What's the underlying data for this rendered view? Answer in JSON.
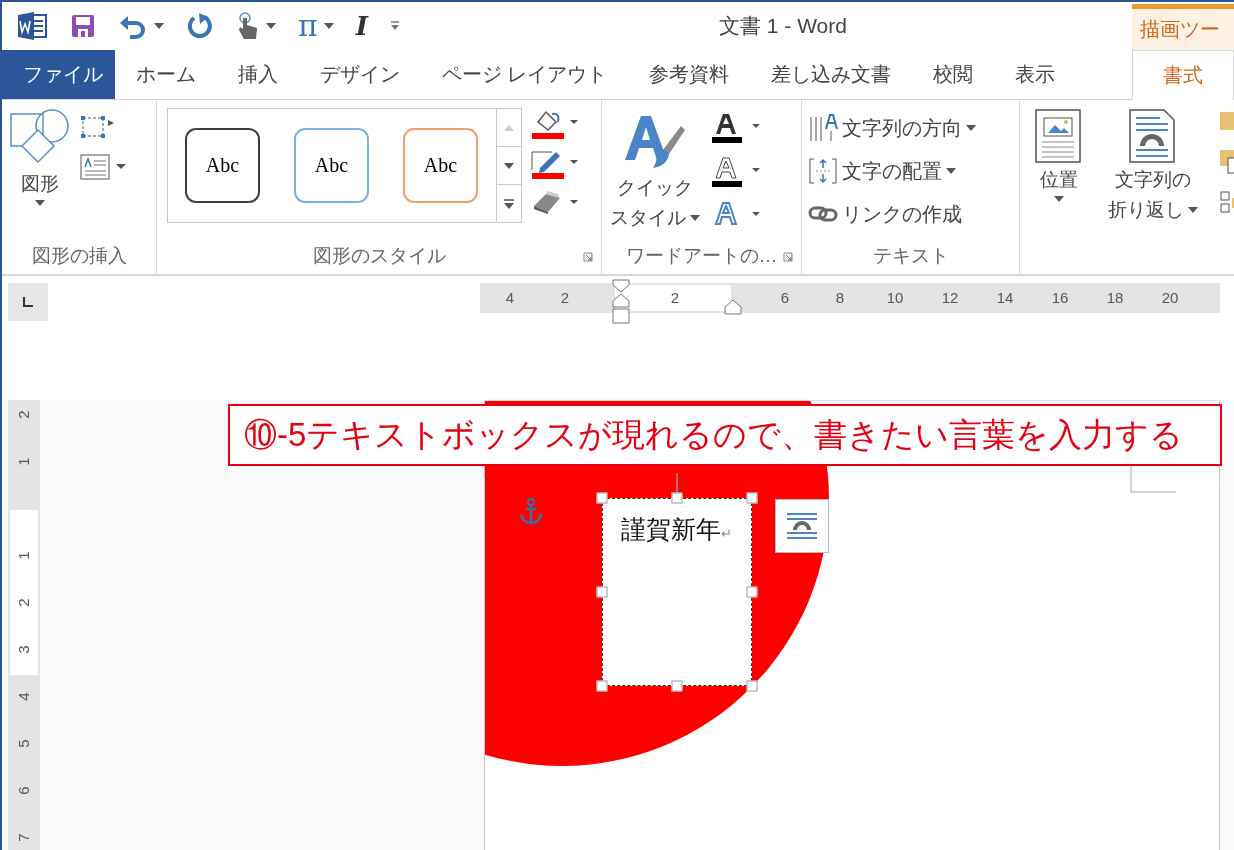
{
  "quick_access": [
    {
      "kind": "word-logo",
      "caret": false
    },
    {
      "kind": "save",
      "caret": false
    },
    {
      "kind": "undo",
      "caret": true
    },
    {
      "kind": "redo",
      "caret": false
    },
    {
      "kind": "touch",
      "caret": true
    },
    {
      "kind": "glyph",
      "glyph": "π",
      "caret": true
    },
    {
      "kind": "glyph",
      "glyph": "I",
      "caret": false
    },
    {
      "kind": "customize",
      "caret": false
    }
  ],
  "window": {
    "title": "文書 1 - Word"
  },
  "context_group": {
    "label": "描画ツー"
  },
  "tabs": [
    {
      "label": "ファイル",
      "kind": "file",
      "selected": false
    },
    {
      "label": "ホーム",
      "kind": "normal",
      "selected": false
    },
    {
      "label": "挿入",
      "kind": "normal",
      "selected": false
    },
    {
      "label": "デザイン",
      "kind": "normal",
      "selected": false
    },
    {
      "label": "ページ レイアウト",
      "kind": "normal",
      "selected": false
    },
    {
      "label": "参考資料",
      "kind": "normal",
      "selected": false
    },
    {
      "label": "差し込み文書",
      "kind": "normal",
      "selected": false
    },
    {
      "label": "校閲",
      "kind": "normal",
      "selected": false
    },
    {
      "label": "表示",
      "kind": "normal",
      "selected": false
    },
    {
      "label": "書式",
      "kind": "contextual",
      "selected": true
    }
  ],
  "ribbon": {
    "groups": [
      {
        "kind": "insert-shapes",
        "label": "図形の挿入",
        "launcher": false,
        "button": {
          "lines": [
            "図形"
          ]
        }
      },
      {
        "kind": "shape-styles",
        "label": "図形のスタイル",
        "launcher": true,
        "styles": [
          {
            "text": "Abc",
            "color": "#404040"
          },
          {
            "text": "Abc",
            "color": "#7eb0e0"
          },
          {
            "text": "Abc",
            "color": "#f0a070"
          }
        ]
      },
      {
        "kind": "wordart",
        "label": "ワードアートの…",
        "launcher": true,
        "button": {
          "lines": [
            "クイック",
            "スタイル"
          ]
        }
      },
      {
        "kind": "text",
        "label": "テキスト",
        "launcher": false,
        "commands": [
          {
            "label": "文字列の方向",
            "caret": true
          },
          {
            "label": "文字の配置",
            "caret": true
          },
          {
            "label": "リンクの作成",
            "caret": false
          }
        ]
      },
      {
        "kind": "arrange",
        "launcher": false,
        "buttons": [
          {
            "lines": [
              "位置"
            ]
          },
          {
            "lines": [
              "文字列の",
              "折り返し"
            ]
          }
        ]
      }
    ]
  },
  "ruler": {
    "horizontal": [
      "4",
      "2",
      "2",
      "6",
      "8",
      "10",
      "12",
      "14",
      "16",
      "18",
      "20"
    ],
    "vertical": [
      "2",
      "1",
      "1",
      "2",
      "3",
      "4",
      "5",
      "6",
      "7"
    ]
  },
  "document": {
    "callout": "⑩-5テキストボックスが現れるので、書きたい言葉を入力する",
    "text_box": {
      "text": "謹賀新年",
      "paragraph_mark": "↵",
      "selected": true
    }
  }
}
